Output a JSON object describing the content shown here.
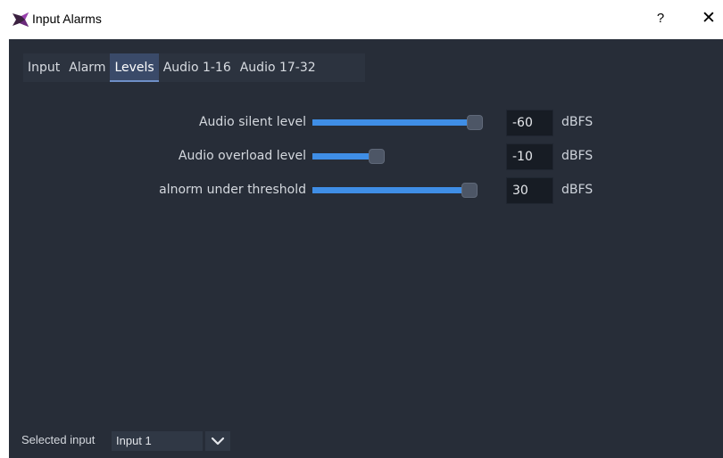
{
  "window": {
    "title": "Input Alarms",
    "help_label": "?",
    "close_label": "✕",
    "icon": "app-logo-icon"
  },
  "tabs": [
    {
      "label": "Input",
      "active": false
    },
    {
      "label": "Alarm",
      "active": false
    },
    {
      "label": "Levels",
      "active": true
    },
    {
      "label": "Audio 1-16",
      "active": false
    },
    {
      "label": "Audio 17-32",
      "active": false
    }
  ],
  "levels": [
    {
      "label": "Audio silent level",
      "value": "-60",
      "unit": "dBFS",
      "slider_fraction": 0.9
    },
    {
      "label": "Audio overload level",
      "value": "-10",
      "unit": "dBFS",
      "slider_fraction": 0.33
    },
    {
      "label": "alnorm under threshold",
      "value": "30",
      "unit": "dBFS",
      "slider_fraction": 0.87
    }
  ],
  "footer": {
    "selected_input_label": "Selected input",
    "selected_input_value": "Input 1",
    "dropdown_icon": "chevron-down-icon"
  },
  "colors": {
    "background": "#272d38",
    "slider_fill": "#3f8ee6",
    "tab_active": "#3a4a69"
  }
}
